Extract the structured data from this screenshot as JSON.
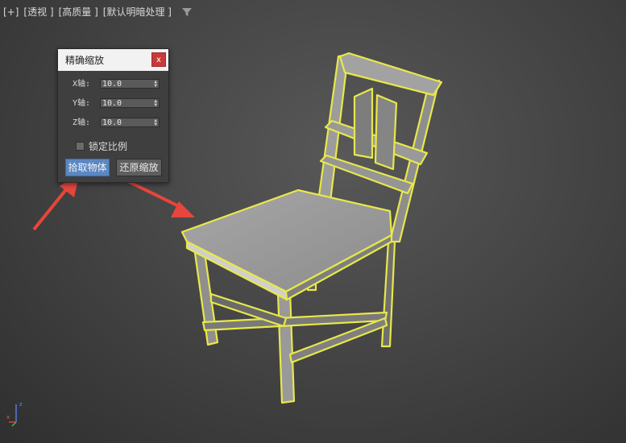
{
  "viewport": {
    "labels": [
      "[+]",
      "[透视 ]",
      "[高质量 ]",
      "[默认明暗处理 ]"
    ],
    "filter_icon": "filter-icon"
  },
  "dialog": {
    "title": "精确缩放",
    "close_label": "x",
    "axes": [
      {
        "label": "X轴:",
        "value": "10.0"
      },
      {
        "label": "Y轴:",
        "value": "10.0"
      },
      {
        "label": "Z轴:",
        "value": "10.0"
      }
    ],
    "lock_ratio_label": "锁定比例",
    "lock_ratio_checked": false,
    "pick_button_label": "拾取物体",
    "reset_button_label": "还原缩放"
  },
  "gizmo": {
    "x": "x",
    "z": "z"
  },
  "colors": {
    "selection_outline": "#e8e84a",
    "arrow": "#e8453c",
    "pick_button": "#5b87c3",
    "close_button": "#c83a3a"
  }
}
